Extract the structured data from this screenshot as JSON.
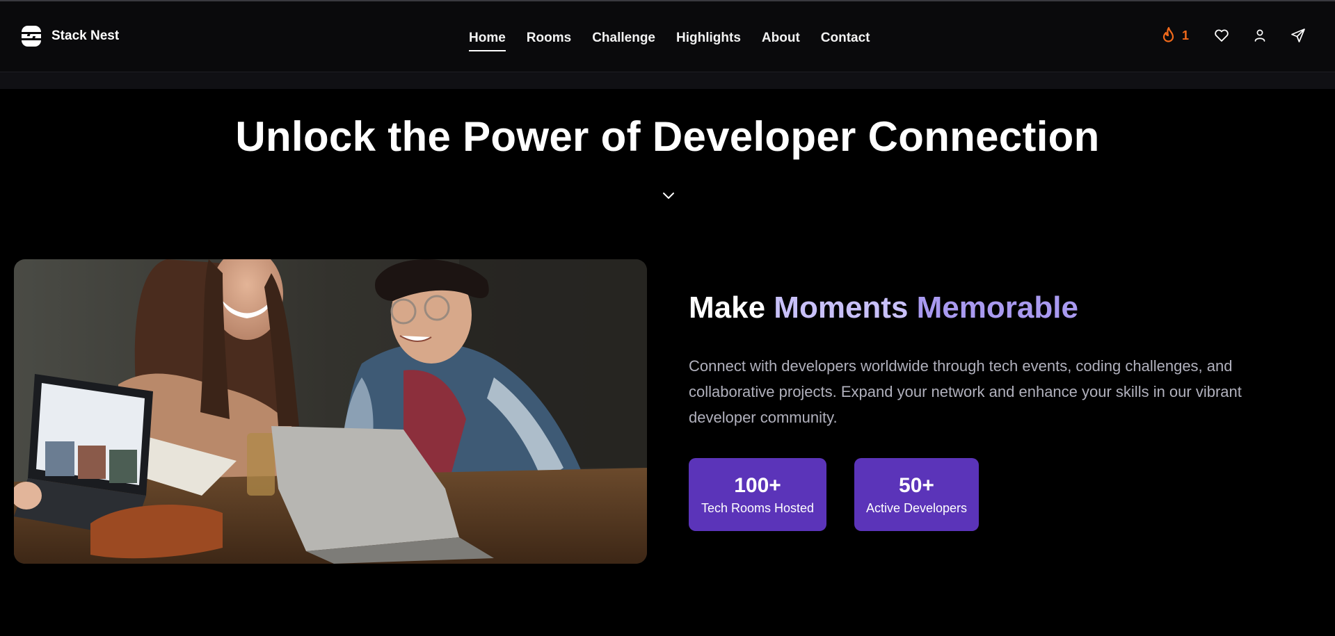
{
  "brand": {
    "name": "Stack Nest",
    "logo_icon": "stack-nest-logo-icon"
  },
  "nav": {
    "links": [
      {
        "label": "Home",
        "active": true
      },
      {
        "label": "Rooms",
        "active": false
      },
      {
        "label": "Challenge",
        "active": false
      },
      {
        "label": "Highlights",
        "active": false
      },
      {
        "label": "About",
        "active": false
      },
      {
        "label": "Contact",
        "active": false
      }
    ],
    "streak": {
      "count": "1",
      "icon": "flame-icon",
      "color": "#f26a1b"
    },
    "icons": [
      "heart-icon",
      "user-icon",
      "send-icon"
    ]
  },
  "hero": {
    "title": "Unlock the Power of Developer Connection",
    "scroll_icon": "chevron-down-icon"
  },
  "section": {
    "image": "developers-laughing-with-laptops-photo",
    "title_plain": "Make ",
    "title_accent_1": "Moments",
    "title_space": " ",
    "title_accent_2": "Memorable",
    "description": "Connect with developers worldwide through tech events, coding challenges, and collaborative projects. Expand your network and enhance your skills in our vibrant developer community.",
    "stats": [
      {
        "value": "100+",
        "label": "Tech Rooms Hosted"
      },
      {
        "value": "50+",
        "label": "Active Developers"
      }
    ]
  },
  "colors": {
    "background": "#000000",
    "navbar": "#0a0a0c",
    "stat_card": "#5b34b9",
    "accent_text": "#c8c0f8",
    "accent_text_2": "#a99af0",
    "description": "#b1b1bd"
  }
}
